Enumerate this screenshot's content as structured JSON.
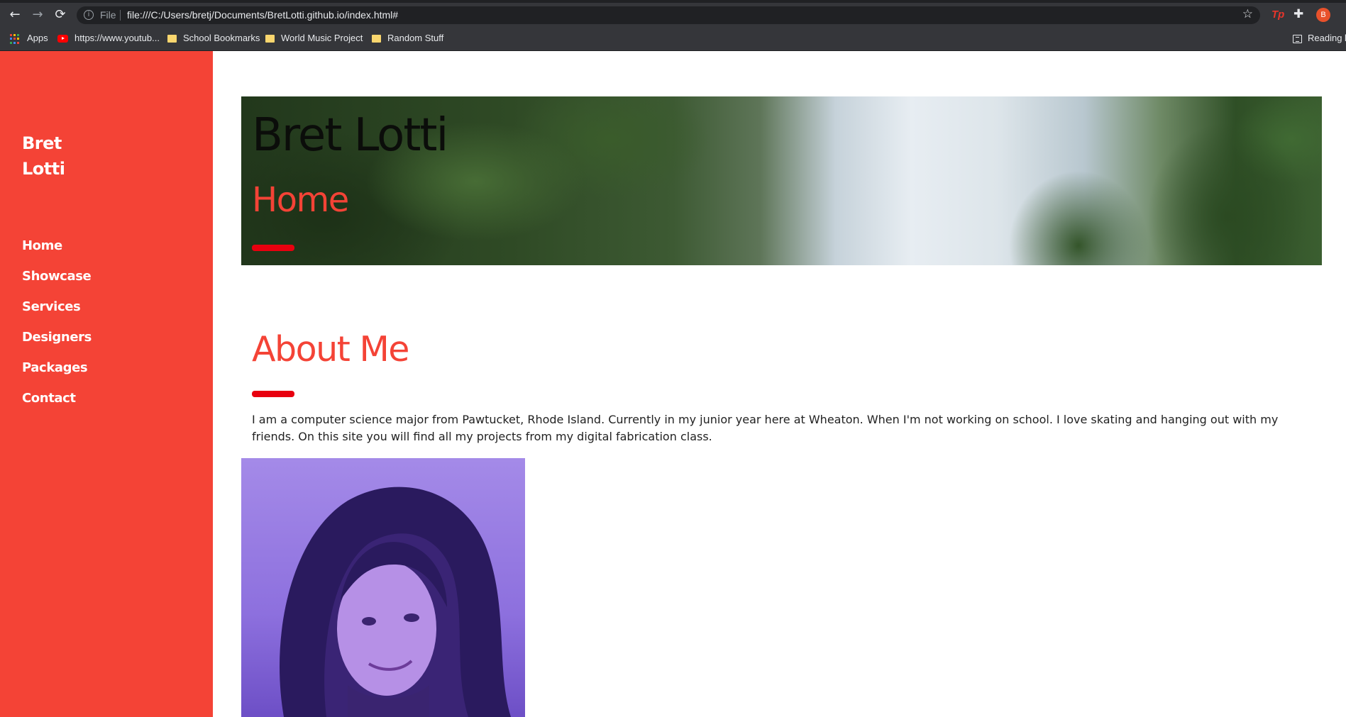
{
  "browser": {
    "nav": {
      "back_icon": "arrow-left-icon",
      "forward_icon": "arrow-right-icon",
      "reload_icon": "reload-icon"
    },
    "address": {
      "scheme_label": "File",
      "url": "file:///C:/Users/bretj/Documents/BretLotti.github.io/index.html#"
    },
    "profile_initial": "B",
    "extensions": {
      "tp_label": "Tp"
    },
    "bookmarks": [
      {
        "label": "Apps",
        "icon": "apps-grid-icon"
      },
      {
        "label": "https://www.youtub...",
        "icon": "youtube-icon"
      },
      {
        "label": "School Bookmarks",
        "icon": "folder-icon"
      },
      {
        "label": "World Music Project",
        "icon": "folder-icon"
      },
      {
        "label": "Random Stuff",
        "icon": "folder-icon"
      }
    ],
    "reading_list_label": "Reading li"
  },
  "site": {
    "brand": "Bret Lotti",
    "nav": [
      "Home",
      "Showcase",
      "Services",
      "Designers",
      "Packages",
      "Contact"
    ],
    "hero": {
      "title": "Bret Lotti",
      "subtitle": "Home"
    },
    "about": {
      "heading": "About Me",
      "text": "I am a computer science major from Pawtucket, Rhode Island. Currently in my junior year here at Wheaton. When I'm not working on school. I love skating and hanging out with my friends. On this site you will find all my projects from my digital fabrication class."
    }
  },
  "colors": {
    "accent": "#f44336",
    "accent_bar": "#e8000f",
    "chrome": "#35363a"
  }
}
